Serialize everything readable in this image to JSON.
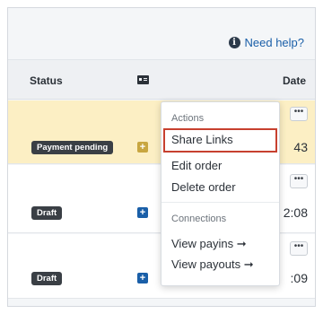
{
  "help": {
    "icon": "info-icon",
    "label": "Need help?"
  },
  "table": {
    "columns": {
      "status": "Status",
      "status_icon": "id-card-icon",
      "date": "Date"
    },
    "rows": [
      {
        "status": "Payment pending",
        "date": "43",
        "highlighted": true
      },
      {
        "status": "Draft",
        "date": "2:08"
      },
      {
        "status": "Draft",
        "date": ":09"
      }
    ]
  },
  "menu": {
    "section_actions": "Actions",
    "items_actions": [
      "Share Links",
      "Edit order",
      "Delete order"
    ],
    "section_connections": "Connections",
    "items_connections": [
      "View payins ➞",
      "View payouts ➞"
    ],
    "selected": "Share Links",
    "selected_outline_color": "#c7402f"
  },
  "more_button_label": "•••",
  "colors": {
    "highlight_row": "#fcefc4",
    "link": "#1a5fa8",
    "badge": "#3a3f45"
  }
}
